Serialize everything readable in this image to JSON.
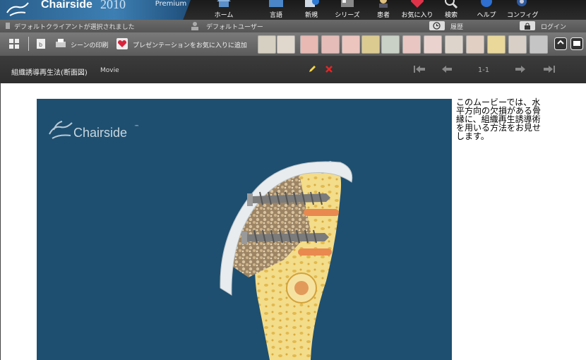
{
  "brand": {
    "name": "Chairside",
    "year": "2010",
    "edition": "Premium"
  },
  "nav": {
    "items": [
      {
        "label": "ホーム",
        "icon": "home-icon"
      },
      {
        "label": "言語",
        "icon": "language-icon"
      },
      {
        "label": "新規",
        "icon": "new-icon"
      },
      {
        "label": "シリーズ",
        "icon": "series-icon"
      },
      {
        "label": "患者",
        "icon": "patient-icon"
      },
      {
        "label": "お気に入り",
        "icon": "favorites-icon"
      },
      {
        "label": "検索",
        "icon": "search-icon"
      },
      {
        "label": "ヘルプ",
        "icon": "help-icon"
      },
      {
        "label": "コンフィグ",
        "icon": "config-icon"
      }
    ]
  },
  "status": {
    "client": "デフォルトクライアントが選択されました",
    "user": "デフォルトユーザー",
    "history": "履歴",
    "login": "ログイン"
  },
  "toolbar": {
    "print_scene": "シーンの印刷",
    "add_favorite": "プレゼンテーションをお気に入りに追加"
  },
  "scene": {
    "title": "組織誘導再生法(断面図)",
    "type": "Movie",
    "page": "1-1"
  },
  "viewer": {
    "watermark": "Chairside"
  },
  "description": "このムービーでは、水平方向の欠損がある骨縁に、組織再生誘導術を用いる方法をお見せします。",
  "colors": {
    "brand_blue": "#3d7fb3",
    "viewer_bg": "#1e4f70",
    "bone": "#f3dc8a"
  }
}
